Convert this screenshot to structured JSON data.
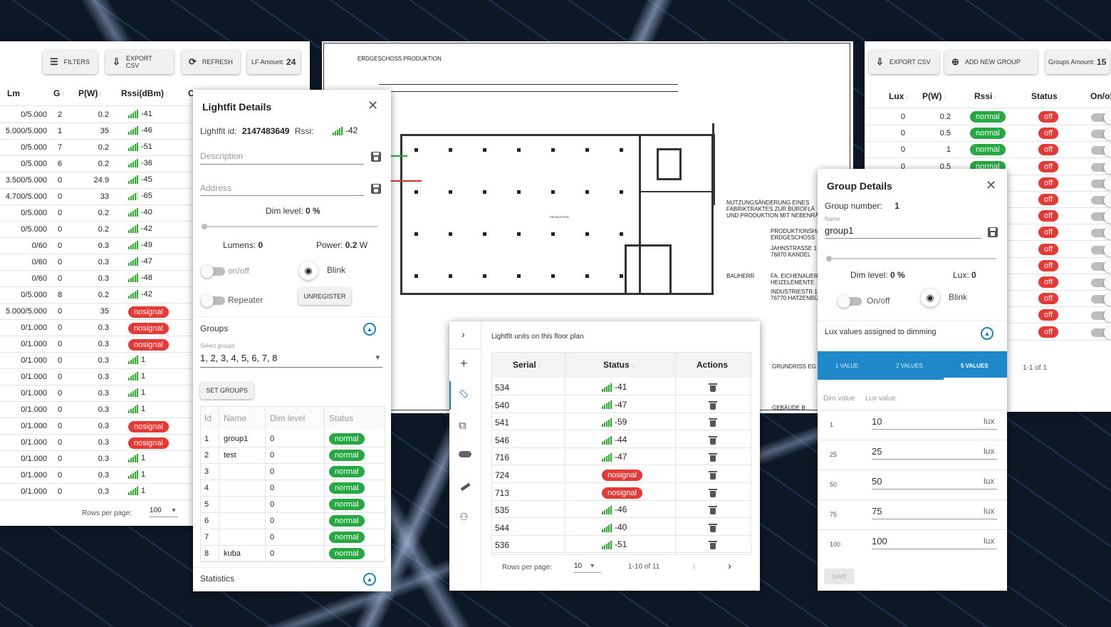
{
  "left_panel": {
    "buttons": {
      "filters": "FILTERS",
      "export_csv": "EXPORT CSV",
      "refresh": "REFRESH",
      "lf_amount_label": "LF Amount:",
      "lf_amount_value": "24"
    },
    "columns": {
      "lm": "Lm",
      "g": "G",
      "pw": "P(W)",
      "rssi": "Rssi(dBm)",
      "c": "C"
    },
    "rows": [
      {
        "lm": "0/5.000",
        "g": "2",
        "pw": "0.2",
        "rssi": "-41",
        "status": "signal",
        "bars": 5
      },
      {
        "lm": "5.000/5.000",
        "g": "1",
        "pw": "35",
        "rssi": "-46",
        "status": "signal",
        "bars": 5
      },
      {
        "lm": "0/5.000",
        "g": "7",
        "pw": "0.2",
        "rssi": "-51",
        "status": "signal",
        "bars": 5
      },
      {
        "lm": "0/5.000",
        "g": "6",
        "pw": "0.2",
        "rssi": "-36",
        "status": "signal",
        "bars": 5
      },
      {
        "lm": "3.500/5.000",
        "g": "0",
        "pw": "24.9",
        "rssi": "-45",
        "status": "signal",
        "bars": 5
      },
      {
        "lm": "4.700/5.000",
        "g": "0",
        "pw": "33",
        "rssi": "-65",
        "status": "signal",
        "bars": 4
      },
      {
        "lm": "0/5.000",
        "g": "0",
        "pw": "0.2",
        "rssi": "-40",
        "status": "signal",
        "bars": 5
      },
      {
        "lm": "0/5.000",
        "g": "0",
        "pw": "0.2",
        "rssi": "-42",
        "status": "signal",
        "bars": 5
      },
      {
        "lm": "0/60",
        "g": "0",
        "pw": "0.3",
        "rssi": "-49",
        "status": "signal",
        "bars": 5
      },
      {
        "lm": "0/60",
        "g": "0",
        "pw": "0.3",
        "rssi": "-47",
        "status": "signal",
        "bars": 5
      },
      {
        "lm": "0/60",
        "g": "0",
        "pw": "0.3",
        "rssi": "-48",
        "status": "signal",
        "bars": 5
      },
      {
        "lm": "0/5.000",
        "g": "8",
        "pw": "0.2",
        "rssi": "-42",
        "status": "signal",
        "bars": 5
      },
      {
        "lm": "5.000/5.000",
        "g": "0",
        "pw": "35",
        "rssi": "nosignal",
        "status": "nosignal",
        "bars": 0
      },
      {
        "lm": "0/1.000",
        "g": "0",
        "pw": "0.3",
        "rssi": "nosignal",
        "status": "nosignal",
        "bars": 0
      },
      {
        "lm": "0/1.000",
        "g": "0",
        "pw": "0.3",
        "rssi": "nosignal",
        "status": "nosignal",
        "bars": 0
      },
      {
        "lm": "0/1.000",
        "g": "0",
        "pw": "0.3",
        "rssi": "1",
        "status": "signal",
        "bars": 5
      },
      {
        "lm": "0/1.000",
        "g": "0",
        "pw": "0.3",
        "rssi": "1",
        "status": "signal",
        "bars": 5
      },
      {
        "lm": "0/1.000",
        "g": "0",
        "pw": "0.3",
        "rssi": "1",
        "status": "signal",
        "bars": 5
      },
      {
        "lm": "0/1.000",
        "g": "0",
        "pw": "0.3",
        "rssi": "1",
        "status": "signal",
        "bars": 5
      },
      {
        "lm": "0/1.000",
        "g": "0",
        "pw": "0.3",
        "rssi": "nosignal",
        "status": "nosignal",
        "bars": 0
      },
      {
        "lm": "0/1.000",
        "g": "0",
        "pw": "0.3",
        "rssi": "nosignal",
        "status": "nosignal",
        "bars": 0
      },
      {
        "lm": "0/1.000",
        "g": "0",
        "pw": "0.3",
        "rssi": "1",
        "status": "signal",
        "bars": 5
      },
      {
        "lm": "0/1.000",
        "g": "0",
        "pw": "0.3",
        "rssi": "1",
        "status": "signal",
        "bars": 5
      },
      {
        "lm": "0/1.000",
        "g": "0",
        "pw": "0.3",
        "rssi": "1",
        "status": "signal",
        "bars": 5
      }
    ],
    "footer": {
      "rows_per_page": "Rows per page:",
      "value": "100"
    }
  },
  "lightfit": {
    "title": "Lightfit Details",
    "id_label": "Lightfit id:",
    "id_value": "2147483649",
    "rssi_label": "Rssi:",
    "rssi_value": "-42",
    "description_placeholder": "Description",
    "address_placeholder": "Address",
    "dim_label": "Dim level:",
    "dim_value": "0 %",
    "lumens_label": "Lumens:",
    "lumens_value": "0",
    "power_label": "Power:",
    "power_value": "0.2",
    "power_unit": "W",
    "onoff": "on/off",
    "blink": "Blink",
    "repeater": "Repeater",
    "unregister": "UNREGISTER",
    "groups_title": "Groups",
    "select_groups_label": "Select groups",
    "select_groups_value": "1, 2, 3, 4, 5, 6, 7, 8",
    "set_groups": "SET GROUPS",
    "table_headers": {
      "id": "Id",
      "name": "Name",
      "dim": "Dim level",
      "status": "Status"
    },
    "groups": [
      {
        "id": "1",
        "name": "group1",
        "dim": "0",
        "status": "normal"
      },
      {
        "id": "2",
        "name": "test",
        "dim": "0",
        "status": "normal"
      },
      {
        "id": "3",
        "name": "",
        "dim": "0",
        "status": "normal"
      },
      {
        "id": "4",
        "name": "",
        "dim": "0",
        "status": "normal"
      },
      {
        "id": "5",
        "name": "",
        "dim": "0",
        "status": "normal"
      },
      {
        "id": "6",
        "name": "",
        "dim": "0",
        "status": "normal"
      },
      {
        "id": "7",
        "name": "",
        "dim": "0",
        "status": "normal"
      },
      {
        "id": "8",
        "name": "kuba",
        "dim": "0",
        "status": "normal"
      }
    ],
    "statistics": "Statistics"
  },
  "floorplan": {
    "title": "ERDGESCHOSS PRODUKTION",
    "text1": "NUTZUNGSÄNDERUNG EINES",
    "text2": "FABRIKTRAKTES ZUR BÜROFLÄ",
    "text3": "UND PRODUKTION MIT NEBENRÄ",
    "text4": "PRODUKTIONSHA",
    "text5": "ERDGESCHOSS",
    "text6": "JAHNSTRASSE 1",
    "text7": "76870 KANDEL",
    "text8": "BAUHERR",
    "text9": "FA. EICHENAUER",
    "text10": "HEIZELEMENTE",
    "text11": "INDUSTRIESTR.1",
    "text12": "76770 HATZENBÜ",
    "text13": "GRUNDRISS EG",
    "text14": "GEBÄUDE B",
    "room": "PRODUKTION"
  },
  "units": {
    "title": "Lightfit units on this floor plan",
    "headers": {
      "serial": "Serial",
      "status": "Status",
      "actions": "Actions"
    },
    "rows": [
      {
        "serial": "534",
        "status": "-41",
        "type": "signal"
      },
      {
        "serial": "540",
        "status": "-47",
        "type": "signal"
      },
      {
        "serial": "541",
        "status": "-59",
        "type": "signal"
      },
      {
        "serial": "546",
        "status": "-44",
        "type": "signal"
      },
      {
        "serial": "716",
        "status": "-47",
        "type": "signal"
      },
      {
        "serial": "724",
        "status": "nosignal",
        "type": "nosignal"
      },
      {
        "serial": "713",
        "status": "nosignal",
        "type": "nosignal"
      },
      {
        "serial": "535",
        "status": "-46",
        "type": "signal"
      },
      {
        "serial": "544",
        "status": "-40",
        "type": "signal"
      },
      {
        "serial": "536",
        "status": "-51",
        "type": "signal"
      }
    ],
    "footer": {
      "rows_per_page": "Rows per page:",
      "value": "10",
      "range": "1-10 of 11"
    }
  },
  "right_panel": {
    "buttons": {
      "export_csv": "EXPORT CSV",
      "add_group": "ADD NEW GROUP",
      "groups_amount_label": "Groups Amount:",
      "groups_amount_value": "15"
    },
    "columns": {
      "lux": "Lux",
      "pw": "P(W)",
      "rssi": "Rssi",
      "status": "Status",
      "onoff": "On/of"
    },
    "rows": [
      {
        "lux": "0",
        "pw": "0.2",
        "rssi": "normal",
        "status": "off"
      },
      {
        "lux": "0",
        "pw": "0.5",
        "rssi": "normal",
        "status": "off"
      },
      {
        "lux": "0",
        "pw": "1",
        "rssi": "normal",
        "status": "off"
      },
      {
        "lux": "0",
        "pw": "0.5",
        "rssi": "normal",
        "status": "off"
      }
    ],
    "extra_status_count": 10,
    "range": "1-1 of 1"
  },
  "group_details": {
    "title": "Group Details",
    "number_label": "Group number:",
    "number_value": "1",
    "name_label": "Name",
    "name_value": "group1",
    "dim_label": "Dim level:",
    "dim_value": "0 %",
    "lux_label": "Lux:",
    "lux_value": "0",
    "onoff": "On/off",
    "blink": "Blink",
    "lux_assigned": "Lux values assigned to dimming",
    "tabs": [
      "1 VALUE",
      "2 VALUES",
      "5 VALUES"
    ],
    "col_dim": "Dim value",
    "col_lux": "Lux value",
    "values": [
      {
        "dim": "1",
        "lux": "10"
      },
      {
        "dim": "25",
        "lux": "25"
      },
      {
        "dim": "50",
        "lux": "50"
      },
      {
        "dim": "75",
        "lux": "75"
      },
      {
        "dim": "100",
        "lux": "100"
      }
    ],
    "unit": "lux",
    "save": "SAVE"
  }
}
